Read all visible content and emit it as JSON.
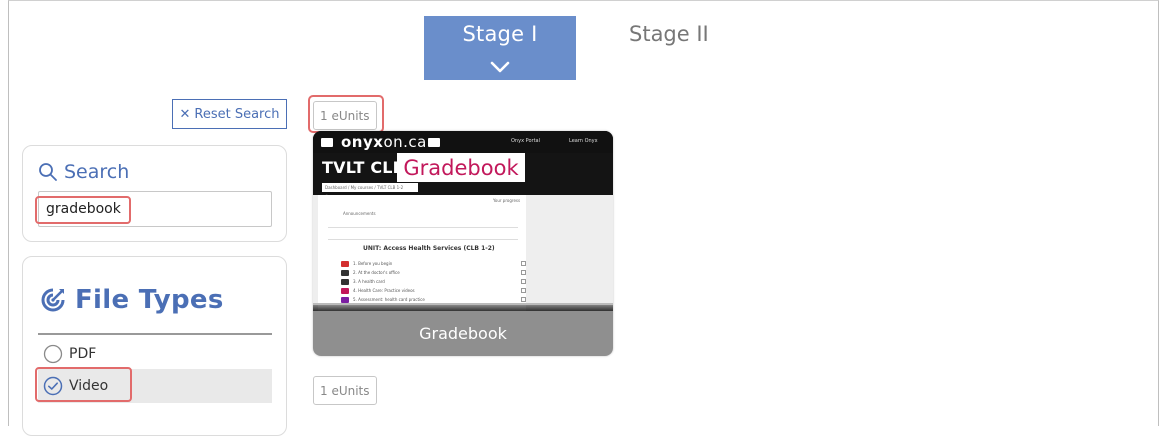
{
  "stages": {
    "active_label": "Stage I",
    "inactive_label": "Stage II"
  },
  "toolbar": {
    "reset_icon": "close-icon",
    "reset_label": "Reset Search"
  },
  "search": {
    "icon": "search-icon",
    "title": "Search",
    "value": "gradebook"
  },
  "file_types": {
    "icon": "target-icon",
    "title": "File Types",
    "options": [
      {
        "label": "PDF",
        "checked": false
      },
      {
        "label": "Video",
        "checked": true
      }
    ]
  },
  "results": {
    "units_top": "1 eUnits",
    "units_bottom": "1 eUnits",
    "card": {
      "title": "Gradebook",
      "thumbnail": {
        "logo_light": "onyx",
        "logo_rest": "on.ca",
        "header": "TVLT CLB",
        "overlay": "Gradebook",
        "breadcrumb": "Dashboard / My courses / TVLT CLB 1-2 Course",
        "nav_left": "Onyx Portal",
        "nav_right": "Learn Onyx",
        "progress_label": "Your progress",
        "announcement": "Announcements",
        "unit_heading": "UNIT: Access Health Services (CLB 1-2)",
        "items": [
          "1. Before you begin",
          "2. At the doctor's office",
          "3. A health card",
          "4. Health Care: Practice videos",
          "5. Assessment: health card practice"
        ]
      }
    }
  }
}
